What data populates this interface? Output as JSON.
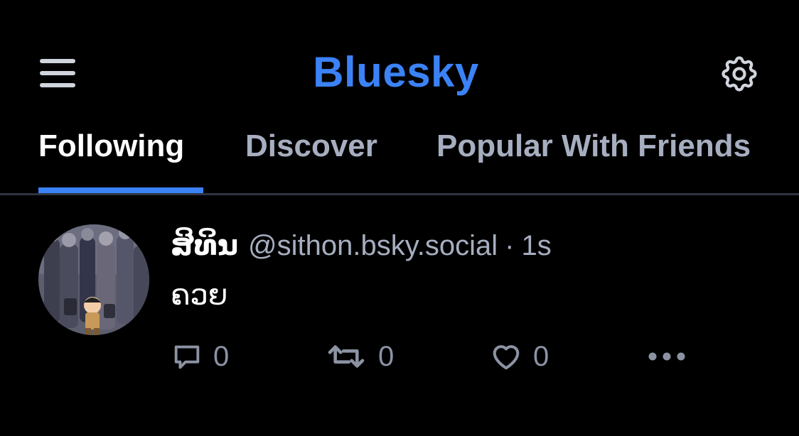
{
  "colors": {
    "background": "#000000",
    "accent": "#3b82f6",
    "text_primary": "#ffffff",
    "text_muted": "#a6aec0",
    "icon_muted": "#8b93a3",
    "divider": "#2e3440"
  },
  "header": {
    "title": "Bluesky",
    "menu_icon": "hamburger-menu-icon",
    "settings_icon": "gear-icon"
  },
  "tabs": [
    {
      "label": "Following",
      "active": true
    },
    {
      "label": "Discover",
      "active": false
    },
    {
      "label": "Popular With Friends",
      "active": false
    }
  ],
  "post": {
    "display_name": "ສິທິນ",
    "handle": "@sithon.bsky.social",
    "separator": "·",
    "time": "1s",
    "text": "ຄວຍ",
    "actions": {
      "reply": {
        "icon": "reply-bubble-icon",
        "count": "0"
      },
      "repost": {
        "icon": "repost-icon",
        "count": "0"
      },
      "like": {
        "icon": "heart-icon",
        "count": "0"
      },
      "more": {
        "icon": "ellipsis-icon"
      }
    }
  }
}
